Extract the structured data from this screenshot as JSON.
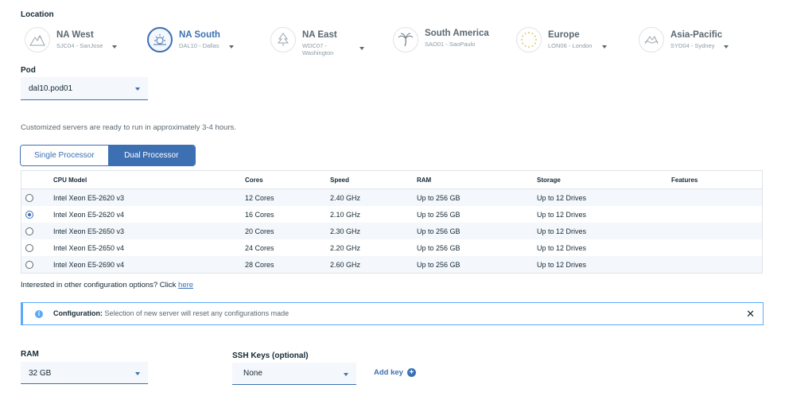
{
  "location": {
    "label": "Location",
    "items": [
      {
        "name": "NA West",
        "sub": "SJC04 - SanJose",
        "selected": false,
        "icon": "mountains-icon"
      },
      {
        "name": "NA South",
        "sub": "DAL10 - Dallas",
        "selected": true,
        "icon": "sun-icon"
      },
      {
        "name": "NA East",
        "sub": "WDC07 - Washington",
        "selected": false,
        "icon": "tree-icon"
      },
      {
        "name": "South America",
        "sub": "SAO01 - SaoPaulo",
        "selected": false,
        "icon": "palm-tree-icon"
      },
      {
        "name": "Europe",
        "sub": "LON06 - London",
        "selected": false,
        "icon": "stars-circle-icon"
      },
      {
        "name": "Asia-Pacific",
        "sub": "SYD04 - Sydney",
        "selected": false,
        "icon": "waves-icon"
      }
    ]
  },
  "pod": {
    "label": "Pod",
    "value": "dal10.pod01"
  },
  "info_text": "Customized servers are ready to run in approximately 3-4 hours.",
  "processor_toggle": {
    "single": "Single Processor",
    "dual": "Dual Processor",
    "active": "dual"
  },
  "table": {
    "headers": [
      "CPU Model",
      "Cores",
      "Speed",
      "RAM",
      "Storage",
      "Features"
    ],
    "rows": [
      {
        "cpu": "Intel Xeon E5-2620 v3",
        "cores": "12 Cores",
        "speed": "2.40 GHz",
        "ram": "Up to 256 GB",
        "storage": "Up to 12 Drives",
        "features": "",
        "selected": false
      },
      {
        "cpu": "Intel Xeon E5-2620 v4",
        "cores": "16 Cores",
        "speed": "2.10 GHz",
        "ram": "Up to 256 GB",
        "storage": "Up to 12 Drives",
        "features": "",
        "selected": true
      },
      {
        "cpu": "Intel Xeon E5-2650 v3",
        "cores": "20 Cores",
        "speed": "2.30 GHz",
        "ram": "Up to 256 GB",
        "storage": "Up to 12 Drives",
        "features": "",
        "selected": false
      },
      {
        "cpu": "Intel Xeon E5-2650 v4",
        "cores": "24 Cores",
        "speed": "2.20 GHz",
        "ram": "Up to 256 GB",
        "storage": "Up to 12 Drives",
        "features": "",
        "selected": false
      },
      {
        "cpu": "Intel Xeon E5-2690 v4",
        "cores": "28 Cores",
        "speed": "2.60 GHz",
        "ram": "Up to 256 GB",
        "storage": "Up to 12 Drives",
        "features": "",
        "selected": false
      }
    ]
  },
  "other_options": {
    "text": "Interested in other configuration options? Click ",
    "link": "here"
  },
  "notification": {
    "title": "Configuration:",
    "message": "Selection of new server will reset any configurations made",
    "icon": "info-icon",
    "close_icon": "close-icon"
  },
  "ram": {
    "label": "RAM",
    "value": "32 GB"
  },
  "ssh": {
    "label": "SSH Keys (optional)",
    "value": "None",
    "add_label": "Add key",
    "add_icon": "plus-circle-icon"
  },
  "colors": {
    "accent": "#3d70b2",
    "info": "#5aaafa",
    "row_alt": "#f4f7fb",
    "text": "#152935"
  }
}
